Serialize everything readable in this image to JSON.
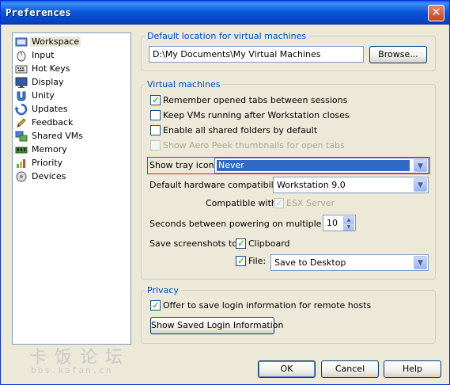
{
  "window": {
    "title": "Preferences",
    "close_glyph": "✕"
  },
  "sidebar": {
    "items": [
      {
        "label": "Workspace",
        "icon": "workspace-icon",
        "selected": true
      },
      {
        "label": "Input",
        "icon": "mouse-icon"
      },
      {
        "label": "Hot Keys",
        "icon": "keyboard-icon"
      },
      {
        "label": "Display",
        "icon": "monitor-icon"
      },
      {
        "label": "Unity",
        "icon": "unity-icon"
      },
      {
        "label": "Updates",
        "icon": "refresh-icon"
      },
      {
        "label": "Feedback",
        "icon": "pencil-icon"
      },
      {
        "label": "Shared VMs",
        "icon": "shared-vms-icon"
      },
      {
        "label": "Memory",
        "icon": "memory-chip-icon"
      },
      {
        "label": "Priority",
        "icon": "priority-icon"
      },
      {
        "label": "Devices",
        "icon": "devices-icon"
      }
    ]
  },
  "default_location": {
    "title": "Default location for virtual machines",
    "path": "D:\\My Documents\\My Virtual Machines",
    "browse_label": "Browse..."
  },
  "virtual_machines": {
    "title": "Virtual machines",
    "remember_tabs": {
      "label": "Remember opened tabs between sessions",
      "checked": true
    },
    "keep_running": {
      "label": "Keep VMs running after Workstation closes",
      "checked": false
    },
    "enable_shared": {
      "label": "Enable all shared folders by default",
      "checked": false
    },
    "aero_peek": {
      "label": "Show Aero Peek thumbnails for open tabs",
      "checked": false,
      "disabled": true
    },
    "tray_icon": {
      "label": "Show tray icon:",
      "value": "Never"
    },
    "hw_compat": {
      "label": "Default hardware compatibility:",
      "value": "Workstation 9.0"
    },
    "compatible_with": {
      "label": "Compatible with:",
      "esx_label": "ESX Server",
      "checked": true,
      "disabled": true
    },
    "power_on_delay": {
      "label": "Seconds between powering on multiple VMs:",
      "value": "10"
    },
    "screenshots": {
      "label": "Save screenshots to:",
      "clipboard_label": "Clipboard",
      "clipboard_checked": true,
      "file_label": "File:",
      "file_checked": true,
      "file_value": "Save to Desktop"
    }
  },
  "privacy": {
    "title": "Privacy",
    "offer_save": {
      "label": "Offer to save login information for remote hosts",
      "checked": true
    },
    "show_saved_label": "Show Saved Login Information"
  },
  "footer": {
    "ok_label": "OK",
    "cancel_label": "Cancel",
    "help_label": "Help"
  },
  "watermark": {
    "line1": "卡饭论坛",
    "line2": "bbs.kafan.cn"
  },
  "colors": {
    "title_blue": "#0a55d9",
    "group_title": "#0046d5",
    "highlight_red": "#e02020",
    "check_green": "#21a121"
  }
}
